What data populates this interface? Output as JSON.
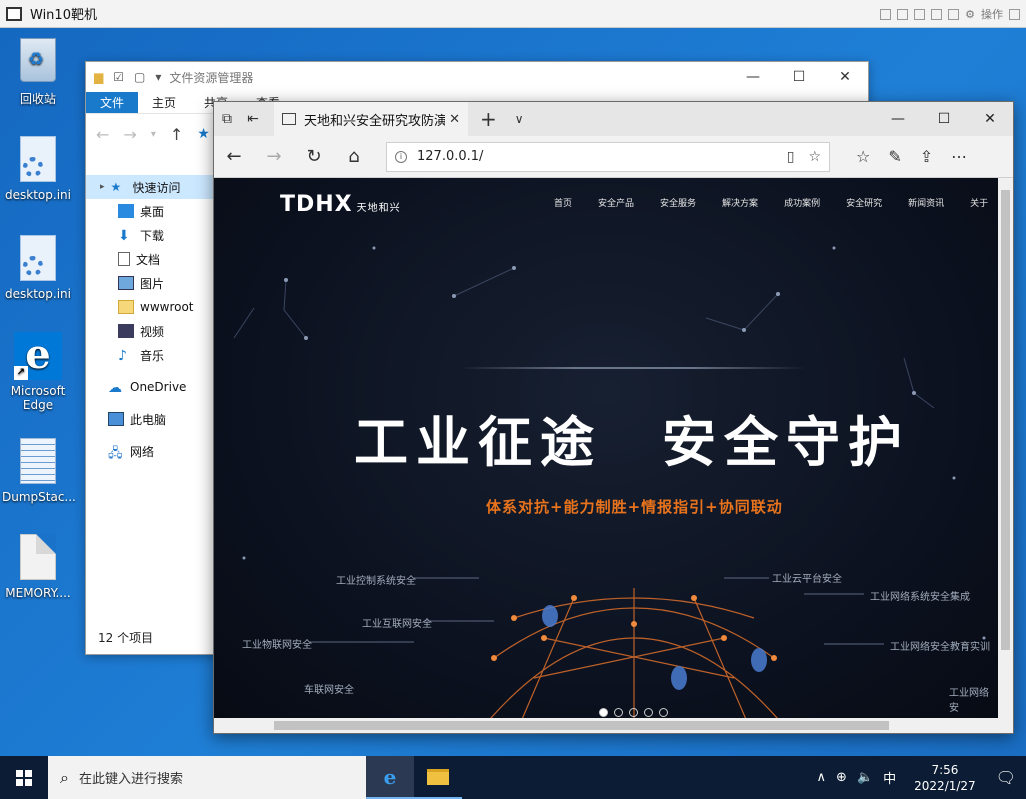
{
  "vm": {
    "title": "Win10靶机",
    "action_label": "操作"
  },
  "desktop": {
    "icons": [
      {
        "label": "回收站"
      },
      {
        "label": "desktop.ini"
      },
      {
        "label": "desktop.ini"
      },
      {
        "label": "Microsoft Edge"
      },
      {
        "label": "DumpStac..."
      },
      {
        "label": "MEMORY...."
      }
    ]
  },
  "explorer": {
    "title": "文件资源管理器",
    "ribbon_tabs": [
      "文件",
      "主页",
      "共享",
      "查看"
    ],
    "sidebar": [
      {
        "label": "快速访问",
        "icon": "star-icon"
      },
      {
        "label": "桌面",
        "icon": "desktop-folder-icon"
      },
      {
        "label": "下载",
        "icon": "download-icon"
      },
      {
        "label": "文档",
        "icon": "document-icon"
      },
      {
        "label": "图片",
        "icon": "pictures-icon"
      },
      {
        "label": "wwwroot",
        "icon": "folder-icon"
      },
      {
        "label": "视频",
        "icon": "video-icon"
      },
      {
        "label": "音乐",
        "icon": "music-icon"
      },
      {
        "label": "OneDrive",
        "icon": "cloud-icon"
      },
      {
        "label": "此电脑",
        "icon": "computer-icon"
      },
      {
        "label": "网络",
        "icon": "network-icon"
      }
    ],
    "status": "12 个项目"
  },
  "edge": {
    "tab_title": "天地和兴安全研究攻防演",
    "url": "127.0.0.1/"
  },
  "site": {
    "logo": "TDHX",
    "logo_cn": "天地和兴",
    "nav": [
      "首页",
      "安全产品",
      "安全服务",
      "解决方案",
      "成功案例",
      "安全研究",
      "新闻资讯",
      "关于"
    ],
    "hero_title_left": "工业征途",
    "hero_title_right": "安全守护",
    "hero_subtitle": "体系对抗+能力制胜+情报指引+协同联动",
    "tags": [
      "工业控制系统安全",
      "工业互联网安全",
      "工业物联网安全",
      "车联网安全",
      "工业云平台安全",
      "工业网络系统安全集成",
      "工业网络安全教育实训",
      "工业网络安"
    ],
    "slide_count": 5,
    "active_slide": 1
  },
  "taskbar": {
    "search_placeholder": "在此键入进行搜索",
    "ime": "中",
    "time": "7:56",
    "date": "2022/1/27"
  },
  "colors": {
    "accent": "#1979ca",
    "site_bg": "#0c1220",
    "site_orange": "#e8731c",
    "taskbar": "#0b1c34"
  }
}
